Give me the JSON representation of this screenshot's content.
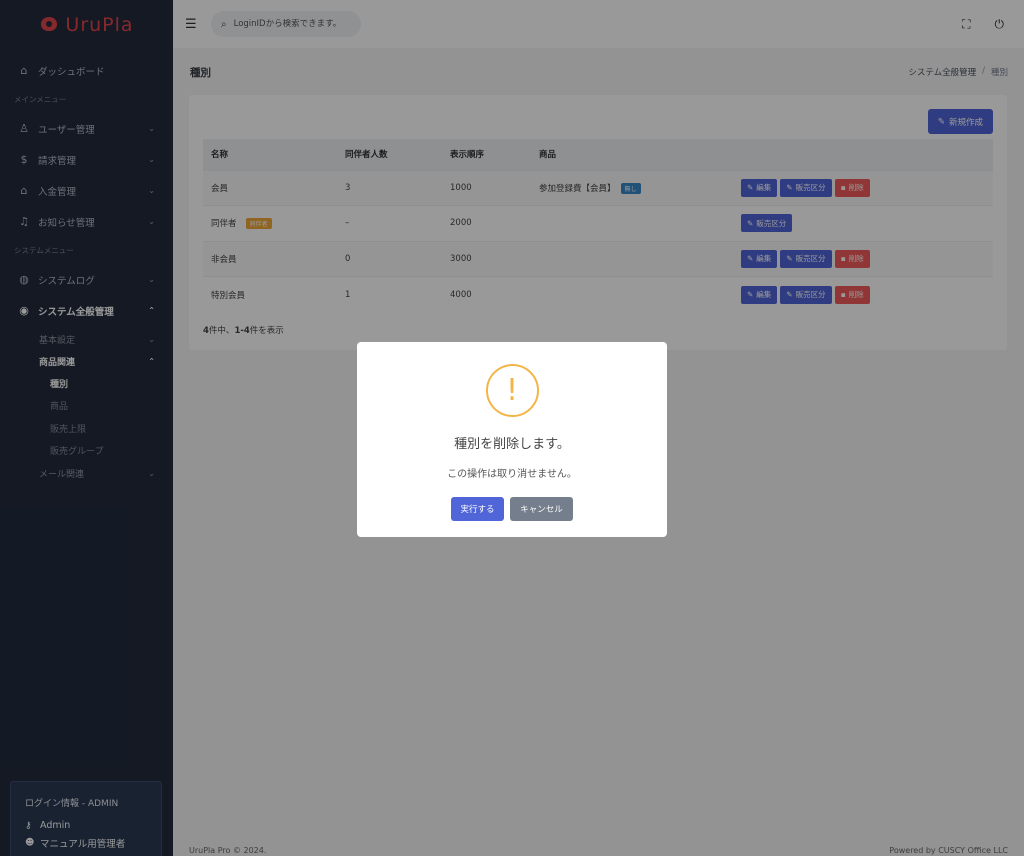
{
  "brand": {
    "name": "UruPla"
  },
  "sidebar": {
    "dashboard": "ダッシュボード",
    "section_main": "メインメニュー",
    "main_items": [
      {
        "label": "ユーザー管理",
        "icon": "user-icon"
      },
      {
        "label": "請求管理",
        "icon": "dollar-icon"
      },
      {
        "label": "入金管理",
        "icon": "bank-icon"
      },
      {
        "label": "お知らせ管理",
        "icon": "bell-icon"
      }
    ],
    "section_system": "システムメニュー",
    "system_log": "システムログ",
    "system_general": "システム全般管理",
    "sub": {
      "basic": "基本設定",
      "products": "商品関連",
      "kind": "種別",
      "product": "商品",
      "limit": "販売上限",
      "group": "販売グループ",
      "mail": "メール関連"
    },
    "login": {
      "title": "ログイン情報 - ADMIN",
      "user": "Admin",
      "role": "マニュアル用管理者"
    }
  },
  "header": {
    "search_placeholder": "LoginIDから検索できます。"
  },
  "page": {
    "title": "種別",
    "breadcrumb": [
      "システム全般管理",
      "/",
      "種別"
    ],
    "new_button": "新規作成"
  },
  "table": {
    "headers": [
      "名称",
      "同伴者人数",
      "表示順序",
      "商品",
      ""
    ],
    "rows": [
      {
        "name": "会員",
        "count": "3",
        "order": "1000",
        "product": "参加登録費【会員】",
        "badge": "無し"
      },
      {
        "name": "同伴者",
        "badge": "同伴者",
        "count": "–",
        "order": "2000",
        "product": ""
      },
      {
        "name": "非会員",
        "count": "0",
        "order": "3000",
        "product": ""
      },
      {
        "name": "特別会員",
        "count": "1",
        "order": "4000",
        "product": ""
      }
    ],
    "actions": {
      "edit": "編集",
      "sales": "販売区分",
      "delete": "削除"
    },
    "count_prefix": "4",
    "count_mid": "件中、",
    "count_range": "1-4",
    "count_suffix": "件を表示"
  },
  "footer": {
    "left": "UruPla Pro © 2024.",
    "right": "Powered by CUSCY Office LLC"
  },
  "modal": {
    "title": "種別を削除します。",
    "text": "この操作は取り消せません。",
    "ok": "実行する",
    "cancel": "キャンセル"
  },
  "colors": {
    "primary": "#5065d8",
    "danger": "#f25b5b",
    "warning": "#f3b548",
    "sidebar": "#222b3d"
  }
}
